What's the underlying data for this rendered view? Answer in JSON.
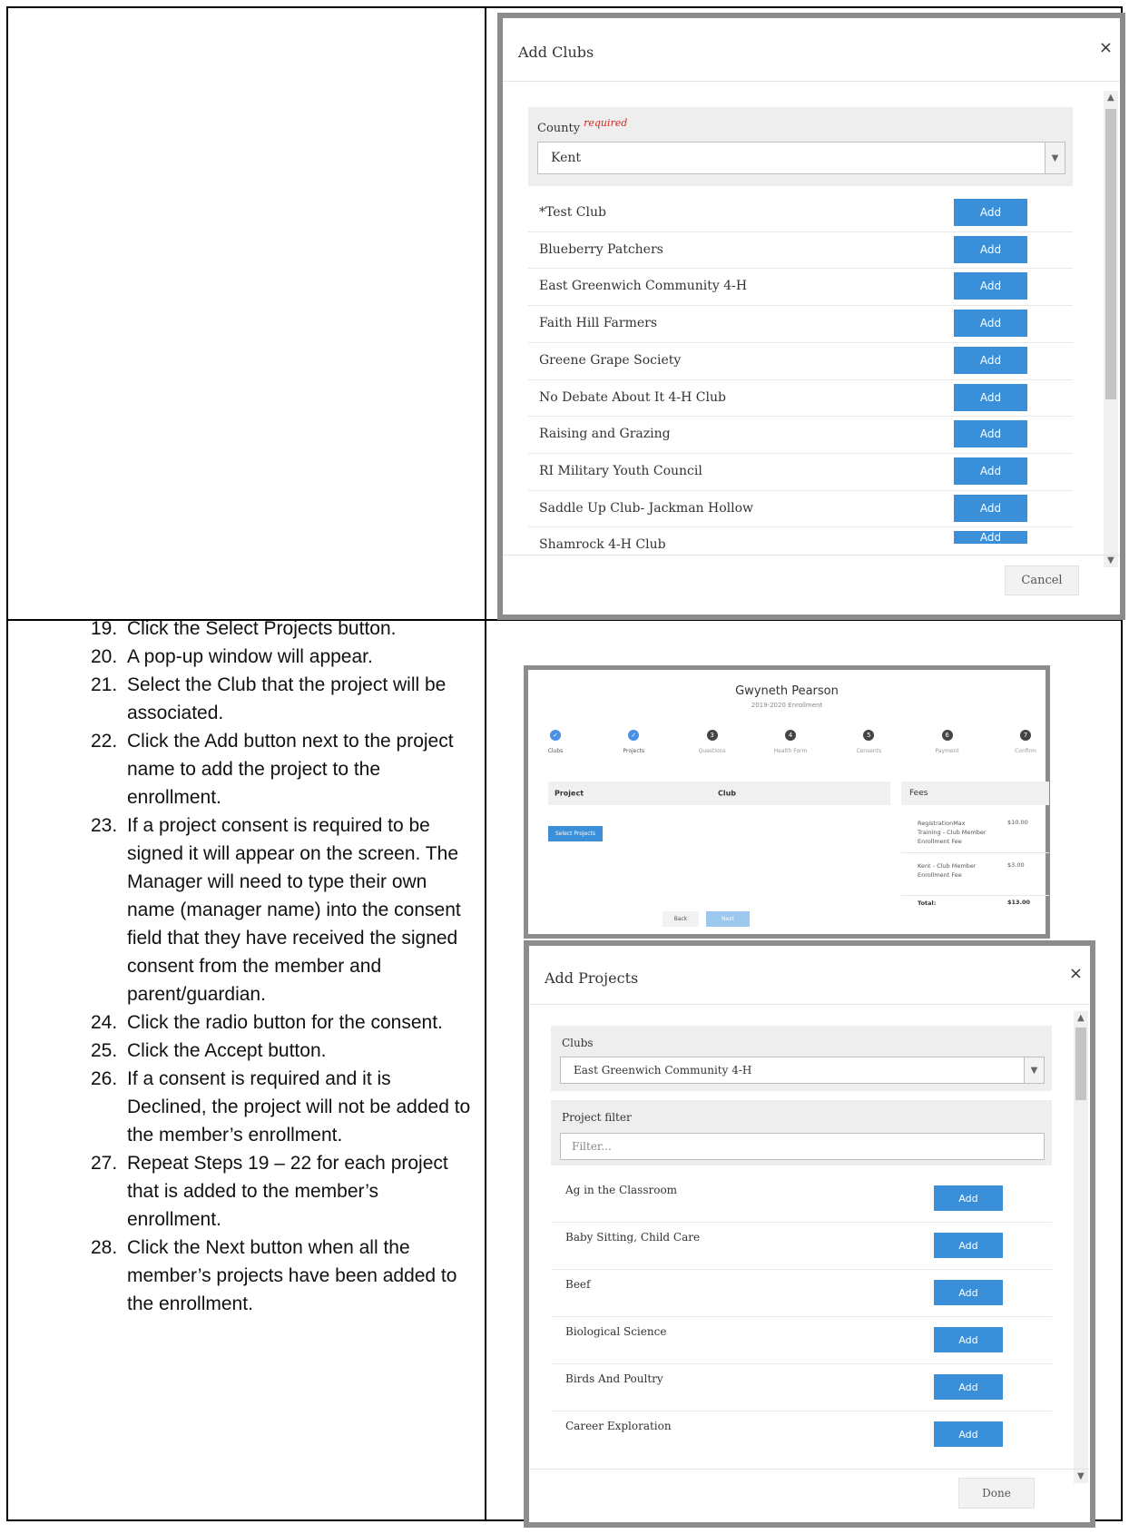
{
  "add_clubs_modal": {
    "title": "Add Clubs",
    "close": "×",
    "county_label": "County",
    "county_required": "required",
    "county_value": "Kent",
    "add_label": "Add",
    "clubs": [
      "*Test Club",
      "Blueberry Patchers",
      "East Greenwich Community 4-H",
      "Faith Hill Farmers",
      "Greene Grape Society",
      "No Debate About It 4-H Club",
      "Raising and Grazing",
      "RI Military Youth Council",
      "Saddle Up Club- Jackman Hollow",
      "Shamrock 4-H Club"
    ],
    "cancel_label": "Cancel"
  },
  "instructions": [
    {
      "num": "19.",
      "text": "Click the Select Projects button."
    },
    {
      "num": "20.",
      "text": "A pop-up window will appear."
    },
    {
      "num": "21.",
      "text": "Select the Club that the project will be associated."
    },
    {
      "num": "22.",
      "text": "Click the Add button next to the project name to add the project to the enrollment."
    },
    {
      "num": "23.",
      "text": "If a project consent is required to be signed it will appear on the screen. The Manager will need to type their own name (manager name) into the consent field that they have received the signed consent from the member and parent/guardian."
    },
    {
      "num": "24.",
      "text": "Click the radio button for the consent."
    },
    {
      "num": "25.",
      "text": "Click the Accept button."
    },
    {
      "num": "26.",
      "text": "If a consent is required and it is Declined, the project will not be added to the member’s enrollment."
    },
    {
      "num": "27.",
      "text": "Repeat Steps 19 – 22 for each project that is added to the member’s enrollment."
    },
    {
      "num": "28.",
      "text": "Click the Next button when all the member’s projects have been added to the enrollment."
    }
  ],
  "enrollment": {
    "member_name": "Gwyneth Pearson",
    "subtitle": "2019-2020 Enrollment",
    "steps": [
      {
        "label": "Clubs",
        "marker": "✓",
        "done": true
      },
      {
        "label": "Projects",
        "marker": "✓",
        "done": true
      },
      {
        "label": "Questions",
        "marker": "3",
        "done": false
      },
      {
        "label": "Health Form",
        "marker": "4",
        "done": false
      },
      {
        "label": "Consents",
        "marker": "5",
        "done": false
      },
      {
        "label": "Payment",
        "marker": "6",
        "done": false
      },
      {
        "label": "Confirm",
        "marker": "7",
        "done": false
      }
    ],
    "project_col": "Project",
    "club_col": "Club",
    "select_projects_label": "Select Projects",
    "fees_title": "Fees",
    "fees": [
      {
        "desc": "RegistrationMax Training - Club Member Enrollment Fee",
        "amount": "$10.00"
      },
      {
        "desc": "Kent - Club Member Enrollment Fee",
        "amount": "$3.00"
      }
    ],
    "total_label": "Total:",
    "total_amount": "$13.00",
    "back_label": "Back",
    "next_label": "Next"
  },
  "add_projects_modal": {
    "title": "Add Projects",
    "close": "×",
    "clubs_label": "Clubs",
    "clubs_value": "East Greenwich Community 4-H",
    "filter_label": "Project filter",
    "filter_placeholder": "Filter...",
    "add_label": "Add",
    "projects": [
      "Ag in the Classroom",
      "Baby Sitting, Child Care",
      "Beef",
      "Biological Science",
      "Birds And Poultry",
      "Career Exploration"
    ],
    "done_label": "Done"
  }
}
